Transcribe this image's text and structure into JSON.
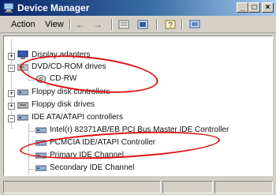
{
  "window": {
    "title": "Device Manager"
  },
  "menu": {
    "action": "Action",
    "view": "View"
  },
  "toolbar": {
    "back": "←",
    "forward": "→"
  },
  "tree": {
    "items": [
      {
        "label": "Display adapters"
      },
      {
        "label": "DVD/CD-ROM drives"
      },
      {
        "label": "CD-RW"
      },
      {
        "label": "Floppy disk controllers"
      },
      {
        "label": "Floppy disk drives"
      },
      {
        "label": "IDE ATA/ATAPI controllers"
      },
      {
        "label": "Intel(r) 82371AB/EB PCI Bus Master IDE Controller"
      },
      {
        "label": "PCMCIA IDE/ATAPI Controller"
      },
      {
        "label": "Primary IDE Channel"
      },
      {
        "label": "Secondary IDE Channel"
      }
    ]
  },
  "colors": {
    "titlebar": "#0a246a",
    "highlight_circle": "#e01010",
    "window_face": "#d4d0c8"
  }
}
